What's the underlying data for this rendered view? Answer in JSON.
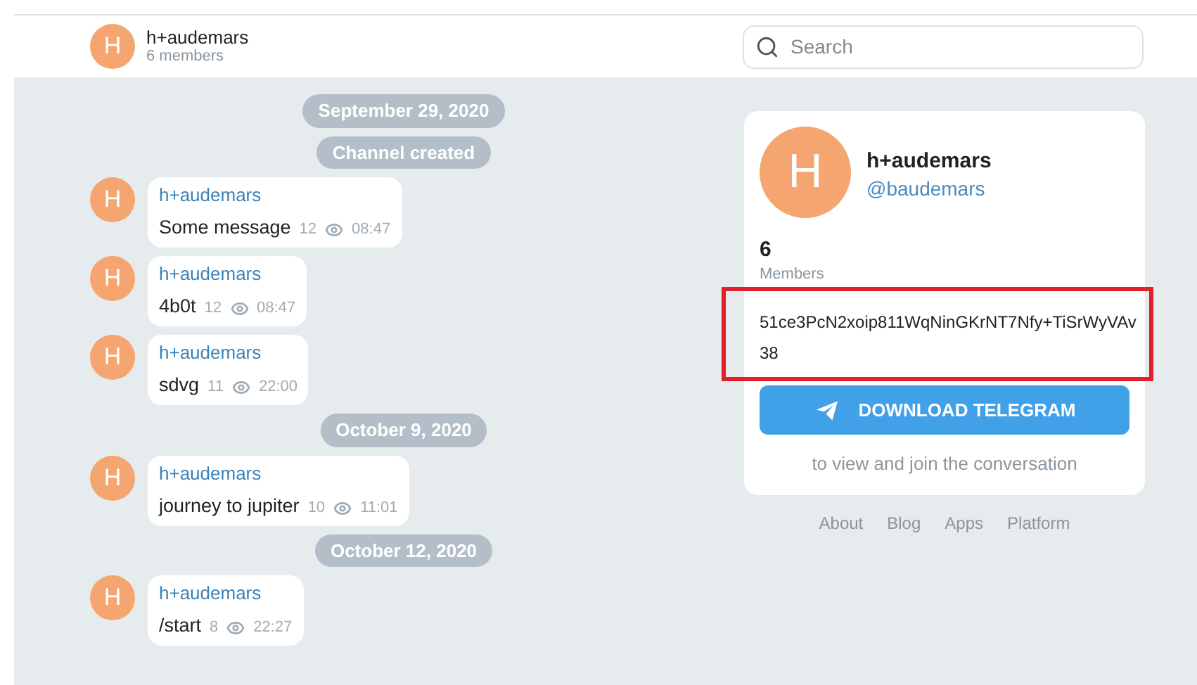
{
  "header": {
    "avatar_letter": "H",
    "title": "h+audemars",
    "subtitle": "6 members",
    "search": {
      "placeholder": "Search"
    }
  },
  "timeline": [
    {
      "kind": "date",
      "text": "September 29, 2020"
    },
    {
      "kind": "service",
      "text": "Channel created"
    },
    {
      "kind": "message",
      "avatar_letter": "H",
      "author": "h+audemars",
      "text": "Some message",
      "views": "12",
      "time": "08:47"
    },
    {
      "kind": "message",
      "avatar_letter": "H",
      "author": "h+audemars",
      "text": "4b0t",
      "views": "12",
      "time": "08:47"
    },
    {
      "kind": "message",
      "avatar_letter": "H",
      "author": "h+audemars",
      "text": "sdvg",
      "views": "11",
      "time": "22:00"
    },
    {
      "kind": "date",
      "text": "October 9, 2020"
    },
    {
      "kind": "message",
      "avatar_letter": "H",
      "author": "h+audemars",
      "text": "journey to jupiter",
      "views": "10",
      "time": "11:01"
    },
    {
      "kind": "date",
      "text": "October 12, 2020"
    },
    {
      "kind": "message",
      "avatar_letter": "H",
      "author": "h+audemars",
      "text": "/start",
      "views": "8",
      "time": "22:27"
    }
  ],
  "channel_card": {
    "avatar_letter": "H",
    "name": "h+audemars",
    "username": "@baudemars",
    "member_count": "6",
    "member_label": "Members",
    "description": "51ce3PcN2xoip811WqNinGKrNT7Nfy+TiSrWyVAv38",
    "description_highlighted": true,
    "button": "DOWNLOAD TELEGRAM",
    "hint": "to view and join the conversation"
  },
  "footer_links": [
    "About",
    "Blog",
    "Apps",
    "Platform"
  ]
}
